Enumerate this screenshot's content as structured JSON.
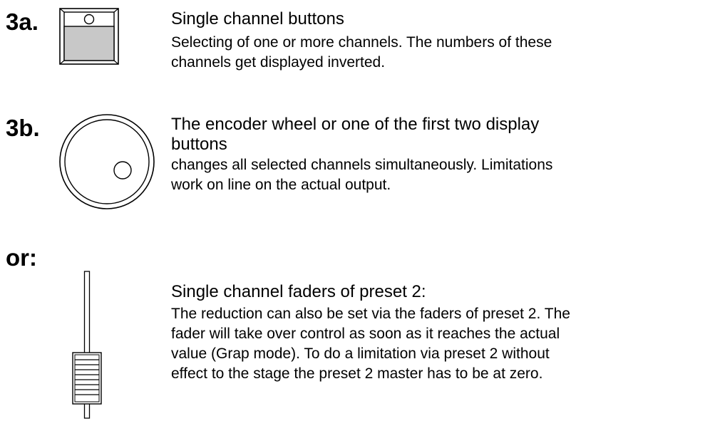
{
  "sections": [
    {
      "label": "3a.",
      "icon": "channel-button-icon",
      "title": "Single channel buttons",
      "description_lines": [
        "Selecting of one or more channels. The numbers of these",
        "channels get displayed inverted."
      ]
    },
    {
      "label": "3b.",
      "icon": "encoder-wheel-icon",
      "title_lines": [
        "The encoder wheel or one of the first two display",
        "buttons"
      ],
      "description_lines": [
        "changes all selected channels simultaneously. Limitations",
        "work on line on the actual output."
      ]
    },
    {
      "label": "or:",
      "icon": "fader-icon",
      "title": "Single channel faders of preset 2:",
      "description_lines": [
        "The reduction can also be set via the faders of preset 2. The",
        "fader will take over control as soon as it reaches the actual",
        "value (Grap mode). To do a limitation via preset 2 without",
        "effect to the stage the preset 2 master has to be at zero."
      ]
    }
  ]
}
